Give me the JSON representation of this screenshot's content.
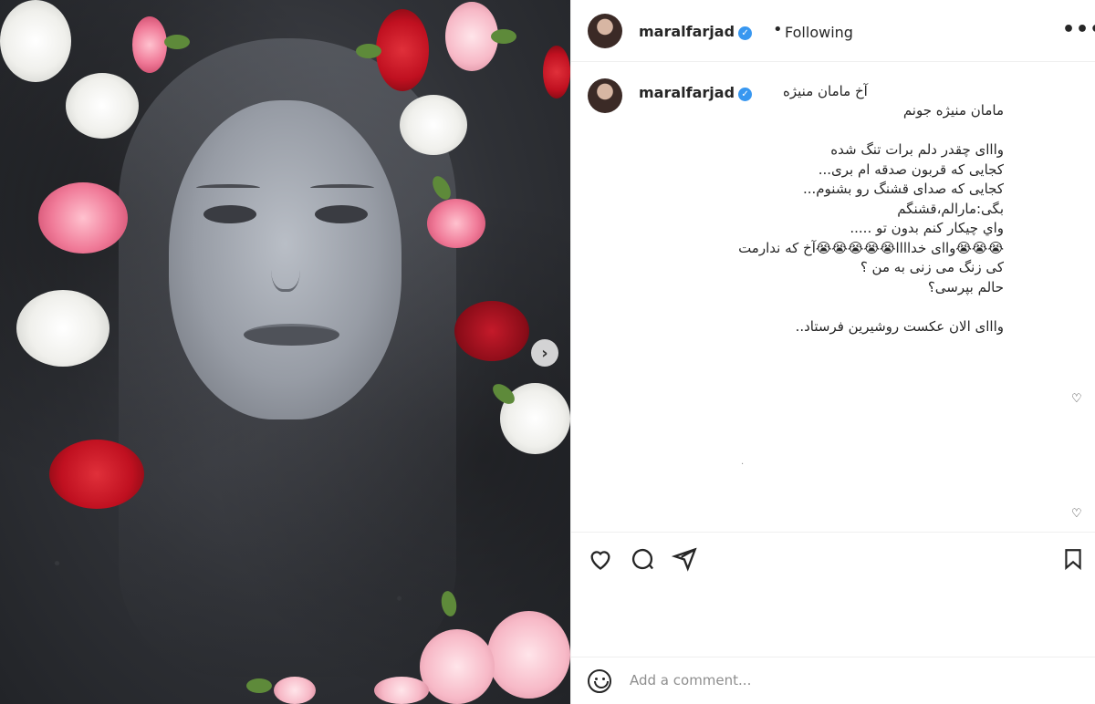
{
  "post": {
    "username": "maralfarjad",
    "follow_status": "Following",
    "more_label": "•••",
    "carousel_next": "›"
  },
  "caption": {
    "username": "maralfarjad",
    "first_line": "آخ مامان منیژه",
    "lines": [
      "مامان منیژه جونم",
      "",
      "وااای چقدر دلم برات تنگ شده",
      "کجایی که قربون صدقه ام بری...",
      "کجایی که صدای قشنگ رو بشنوم...",
      "بگی:مارالم،قشنگم",
      "واي چیکار کنم بدون تو .....",
      "😭😭😭واای خداااا😭😭😭😭😭آخ که ندارمت",
      "کی زنگ می زنی به من ؟",
      "حالم بپرسی؟",
      "",
      "وااای الان عکست روشیرین فرستاد.."
    ],
    "tiny_dot": "."
  },
  "icons": {
    "like": "heart-icon",
    "comment": "comment-icon",
    "share": "share-icon",
    "save": "bookmark-icon",
    "small_like": "heart-icon",
    "emoji": "emoji-icon"
  },
  "comment_box": {
    "placeholder": "Add a comment..."
  },
  "colors": {
    "verified": "#3897f0",
    "text": "#262626",
    "muted": "#8e8e8e",
    "border": "#efefef"
  }
}
